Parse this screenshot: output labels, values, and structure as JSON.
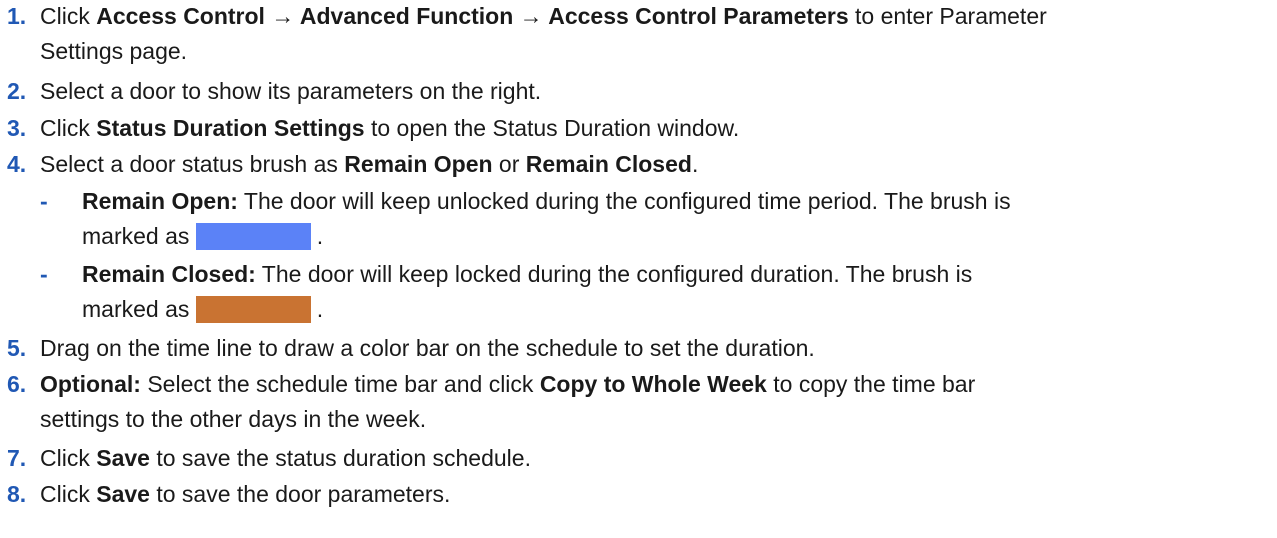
{
  "colors": {
    "step_number": "#2058b4",
    "remain_open_brush": "#5b82f7",
    "remain_closed_brush": "#c97332"
  },
  "top_fragment": "p",
  "steps": [
    {
      "num": "1.",
      "parts": {
        "p1": "Click ",
        "b1": "Access Control → Advanced Function → Access Control Parameters",
        "p2": " to enter Parameter",
        "line2": "Settings page."
      }
    },
    {
      "num": "2.",
      "parts": {
        "p1": "Select a door to show its parameters on the right."
      }
    },
    {
      "num": "3.",
      "parts": {
        "p1": "Click ",
        "b1": "Status Duration Settings",
        "p2": " to open the Status Duration window."
      }
    },
    {
      "num": "4.",
      "parts": {
        "p1": "Select a door status brush as ",
        "b1": "Remain Open",
        "p2": " or ",
        "b2": "Remain Closed",
        "p3": "."
      }
    },
    {
      "num": "5.",
      "parts": {
        "p1": "Drag on the time line to draw a color bar on the schedule to set the duration."
      }
    },
    {
      "num": "6.",
      "parts": {
        "b0": "Optional:",
        "p1": " Select the schedule time bar and click ",
        "b1": "Copy to Whole Week",
        "p2": " to copy the time bar",
        "line2": "settings to the other days in the week."
      }
    },
    {
      "num": "7.",
      "parts": {
        "p1": "Click ",
        "b1": "Save",
        "p2": " to save the status duration schedule."
      }
    },
    {
      "num": "8.",
      "parts": {
        "p1": "Click ",
        "b1": "Save",
        "p2": " to save the door parameters."
      }
    }
  ],
  "substeps": [
    {
      "dash": "-",
      "label": "Remain Open:",
      "text": " The door will keep unlocked during the configured time period. The brush is",
      "line2_prefix": "marked as ",
      "line2_suffix": "."
    },
    {
      "dash": "-",
      "label": "Remain Closed:",
      "text": " The door will keep locked during the configured duration. The brush is",
      "line2_prefix": "marked as ",
      "line2_suffix": "."
    }
  ]
}
